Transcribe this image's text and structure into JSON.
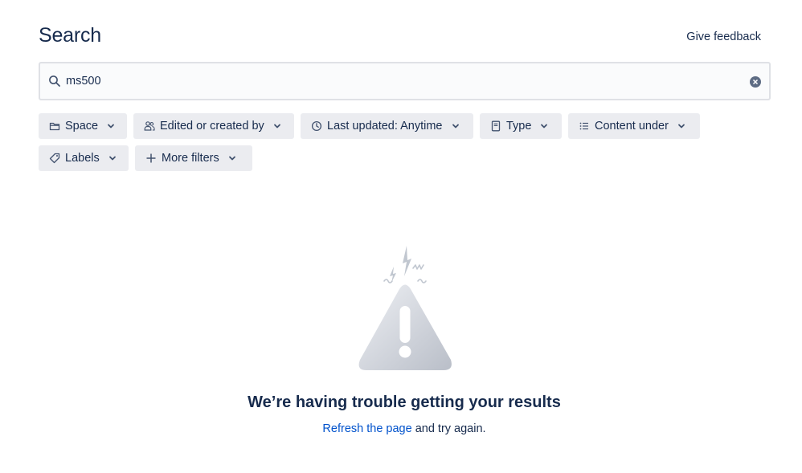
{
  "header": {
    "title": "Search",
    "feedback_label": "Give feedback"
  },
  "search": {
    "value": "ms500",
    "search_icon": "search-icon",
    "clear_icon": "clear-icon"
  },
  "filters": [
    {
      "label": "Space",
      "icon": "folder-icon"
    },
    {
      "label": "Edited or created by",
      "icon": "people-icon"
    },
    {
      "label": "Last updated: Anytime",
      "icon": "clock-icon"
    },
    {
      "label": "Type",
      "icon": "page-icon"
    },
    {
      "label": "Content under",
      "icon": "list-icon"
    },
    {
      "label": "Labels",
      "icon": "tag-icon"
    },
    {
      "label": "More filters",
      "icon": "plus-icon"
    }
  ],
  "error": {
    "illustration": "warning-triangle-icon",
    "title": "We’re having trouble getting your results",
    "link_text": "Refresh the page",
    "rest_text": " and try again."
  },
  "colors": {
    "text": "#172b4d",
    "link": "#0052cc",
    "filter_bg": "#ebecf0",
    "input_border": "#dfe1e6"
  }
}
